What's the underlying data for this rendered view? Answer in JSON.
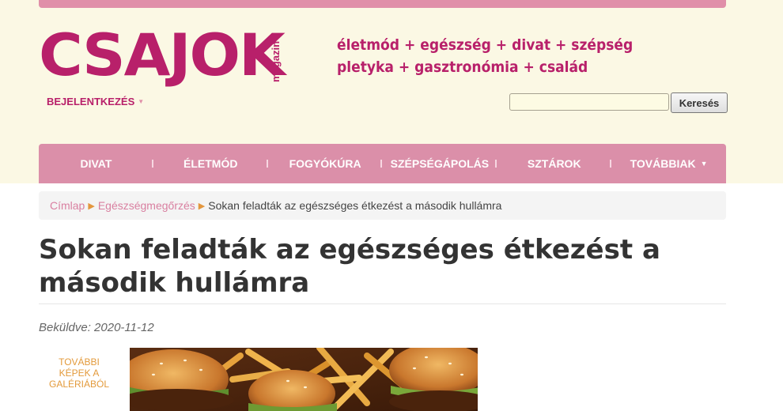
{
  "brand": {
    "logo_text": "CSAJOK",
    "logo_sub": "magazin",
    "tagline_line1": "életmód + egészség + divat + szépség",
    "tagline_line2": "pletyka + gasztronómia + család",
    "accent_color": "#b8206a",
    "nav_color": "#db8fa9"
  },
  "header": {
    "login_label": "BEJELENTKEZÉS",
    "search_placeholder": "",
    "search_button": "Keresés"
  },
  "nav": {
    "items": [
      {
        "label": "DIVAT"
      },
      {
        "label": "ÉLETMÓD"
      },
      {
        "label": "FOGYÓKÚRA"
      },
      {
        "label": "SZÉPSÉGÁPOLÁS"
      },
      {
        "label": "SZTÁROK"
      },
      {
        "label": "TOVÁBBIAK"
      }
    ]
  },
  "breadcrumb": {
    "home": "Címlap",
    "section": "Egészségmegőrzés",
    "current": "Sokan feladták az egészséges étkezést a második hullámra"
  },
  "article": {
    "title": "Sokan feladták az egészséges étkezést a második hullámra",
    "submitted": "Beküldve: 2020-11-12",
    "gallery_link": "További képek a galériából",
    "hero_image_icon": "burgers-and-fries-photo"
  }
}
